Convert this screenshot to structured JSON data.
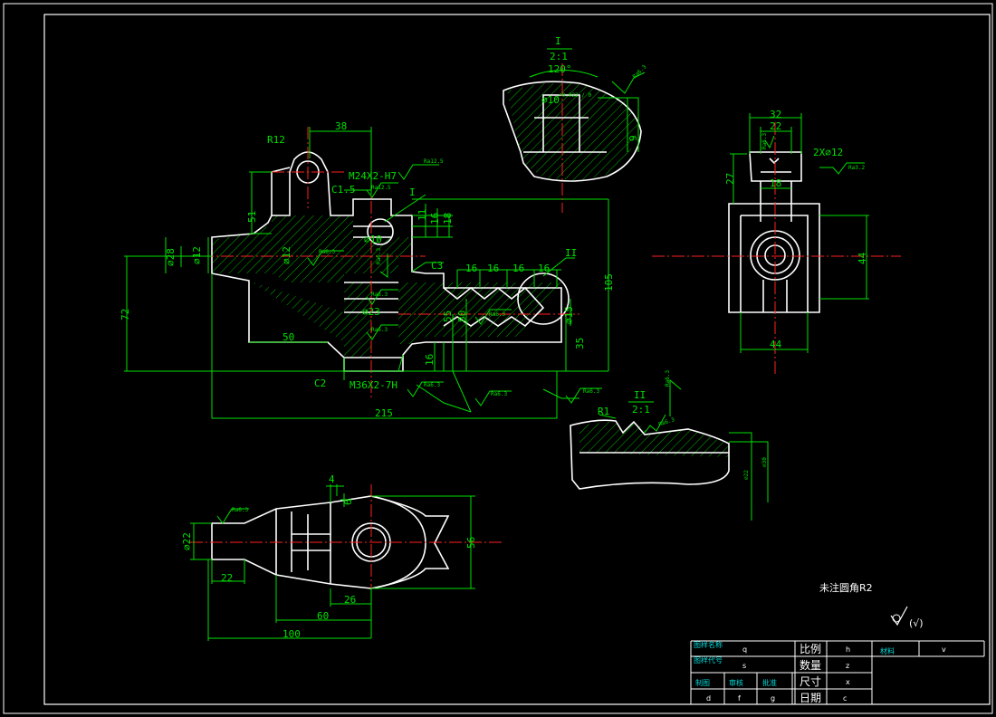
{
  "colors": {
    "background": "#000000",
    "outline": "#ffffff",
    "dimension": "#00e000",
    "centerline": "#ff2020",
    "titleblock_label": "#00d8d8"
  },
  "front_view": {
    "dims": {
      "d38": "38",
      "r12": "R12",
      "thread_top": "M24X2-H7",
      "c15": "C1.5",
      "i_mark": "I",
      "d51": "51",
      "d11": "11",
      "d16a": "16",
      "d18": "18",
      "d28": "⌀28",
      "d12a": "⌀12",
      "d12b": "⌀12",
      "d10": "⌀10",
      "c3": "C3",
      "ii_mark": "II",
      "d16_1": "16",
      "d16_2": "16",
      "d16_3": "16",
      "d16_4": "16",
      "d105": "105",
      "d72": "72",
      "d23": "⌀23",
      "d55": "55",
      "d80": "80",
      "d15": "⌀15",
      "d50": "50",
      "d35": "35",
      "d16b": "16",
      "c2": "C2",
      "thread_bot": "M36X2-7H",
      "d215": "215"
    },
    "roughness": [
      "Ra12.5",
      "Ra12.5",
      "Ra6.3",
      "Ra6.3",
      "Ra6.3",
      "Ra6.3",
      "Ra6.3",
      "Ra6.3",
      "Ra6.3",
      "Ra6.3",
      "Ra6.3"
    ]
  },
  "detail_i": {
    "label": "I",
    "scale": "2:1",
    "angle": "120°",
    "dia": "⌀10",
    "tol": "+0.022 / 0",
    "depth": "9",
    "ra": "Ra6.3"
  },
  "detail_ii": {
    "label": "II",
    "scale": "2:1",
    "radius": "R1",
    "d22": "⌀22",
    "d30": "⌀30",
    "ra_a": "Ra6.3",
    "ra_b": "Ra6.3",
    "ra_c": "Ra6.3"
  },
  "side_view": {
    "d32": "32",
    "d22": "22",
    "d27": "27",
    "d18": "18",
    "holes": "2X⌀12",
    "d44v": "44",
    "d44h": "44",
    "ra_a": "Ra6.3",
    "ra_b": "Ra3.2"
  },
  "top_view": {
    "d4": "4",
    "d6": "6",
    "d22dia": "⌀22",
    "d22": "22",
    "d56": "56",
    "d26": "26",
    "d60": "60",
    "d100": "100",
    "ra": "Ra6.3"
  },
  "notes": {
    "fillet": "未注圆角R2",
    "rough_rest": "(√)"
  },
  "title_block": {
    "design_label": "图样名称",
    "design_value": "q",
    "code_label": "图样代号",
    "code_value": "s",
    "scale_label": "比例",
    "scale_value": "h",
    "material_label": "材料",
    "material_value": "v",
    "qty_label": "数量",
    "qty_value": "z",
    "size_label": "尺寸",
    "size_value": "x",
    "date_label": "日期",
    "date_value": "c",
    "drawn_label": "制图",
    "check_label": "审核",
    "approve_label": "批准",
    "drawn_value": "d",
    "check_value": "f",
    "approve_value": "g"
  }
}
